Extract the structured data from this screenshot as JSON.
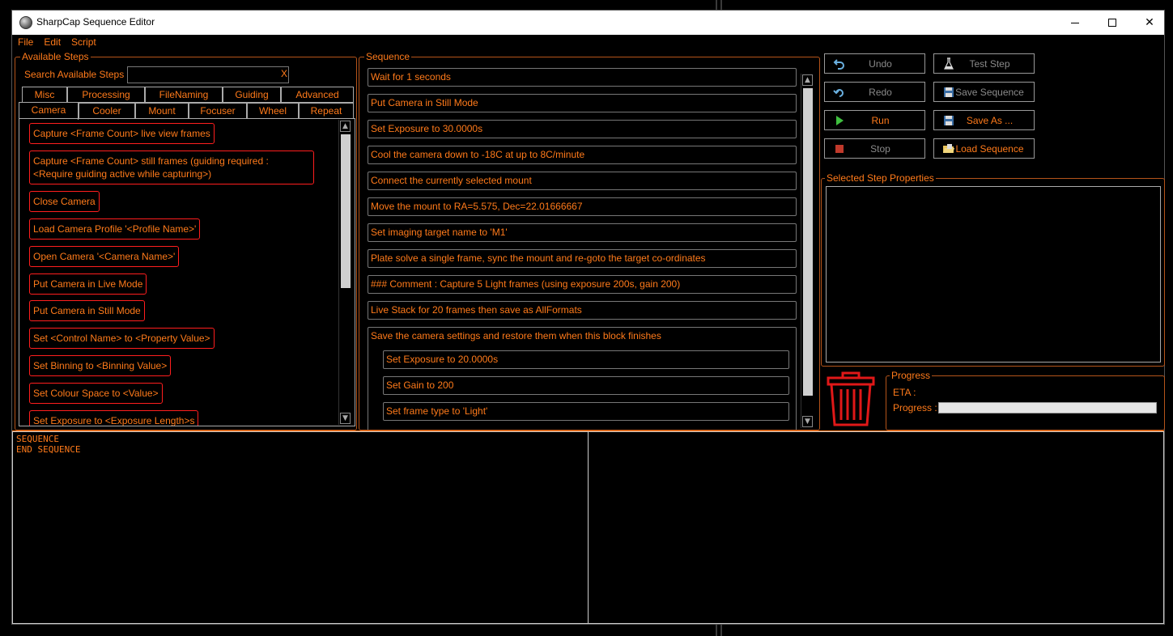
{
  "window": {
    "title": "SharpCap Sequence Editor"
  },
  "menu": [
    "File",
    "Edit",
    "Script"
  ],
  "available_steps": {
    "legend": "Available Steps",
    "search_label": "Search Available Steps",
    "search_value": "",
    "clear_label": "X",
    "tabs_row1": [
      "Misc",
      "Processing",
      "FileNaming",
      "Guiding",
      "Advanced"
    ],
    "tabs_row2": [
      "Camera",
      "Cooler",
      "Mount",
      "Focuser",
      "Wheel",
      "Repeat"
    ],
    "active_tab": "Camera",
    "items": [
      "Capture <Frame Count> live view frames",
      "Capture <Frame Count> still frames (guiding required : <Require guiding active while capturing>)",
      "Close Camera",
      "Load Camera Profile '<Profile Name>'",
      "Open Camera '<Camera Name>'",
      "Put Camera in Live Mode",
      "Put Camera in Still Mode",
      "Set <Control Name> to <Property Value>",
      "Set Binning to <Binning Value>",
      "Set Colour Space to <Value>",
      "Set Exposure to <Exposure Length>s"
    ]
  },
  "sequence": {
    "legend": "Sequence",
    "steps": [
      "Wait for 1 seconds",
      "Put Camera in Still Mode",
      "Set Exposure to 30.0000s",
      "Cool the camera down to -18C at up to 8C/minute",
      "Connect the currently selected mount",
      "Move the mount to RA=5.575, Dec=22.01666667",
      "Set imaging target name to 'M1'",
      "Plate solve a single frame, sync the mount and re-goto the target co-ordinates",
      "### Comment : Capture 5 Light frames (using exposure 200s, gain 200)",
      "Live Stack for 20 frames then save as AllFormats"
    ],
    "block": {
      "label": "Save the camera settings and restore them when this block finishes",
      "children": [
        "Set Exposure to 20.0000s",
        "Set Gain to 200",
        "Set frame type to 'Light'"
      ]
    }
  },
  "buttons": {
    "undo": "Undo",
    "redo": "Redo",
    "run": "Run",
    "stop": "Stop",
    "test_step": "Test Step",
    "save_sequence": "Save Sequence",
    "save_as": "Save As ...",
    "load_sequence": "Load Sequence"
  },
  "properties": {
    "legend": "Selected Step Properties"
  },
  "progress": {
    "legend": "Progress",
    "eta_label": "ETA :",
    "eta_value": "",
    "progress_label": "Progress :",
    "progress_fraction": 0
  },
  "script_text": "SEQUENCE\nEND SEQUENCE",
  "colors": {
    "accent": "#ff7a1a",
    "item_border": "#ff1e1e",
    "background": "#000000"
  }
}
